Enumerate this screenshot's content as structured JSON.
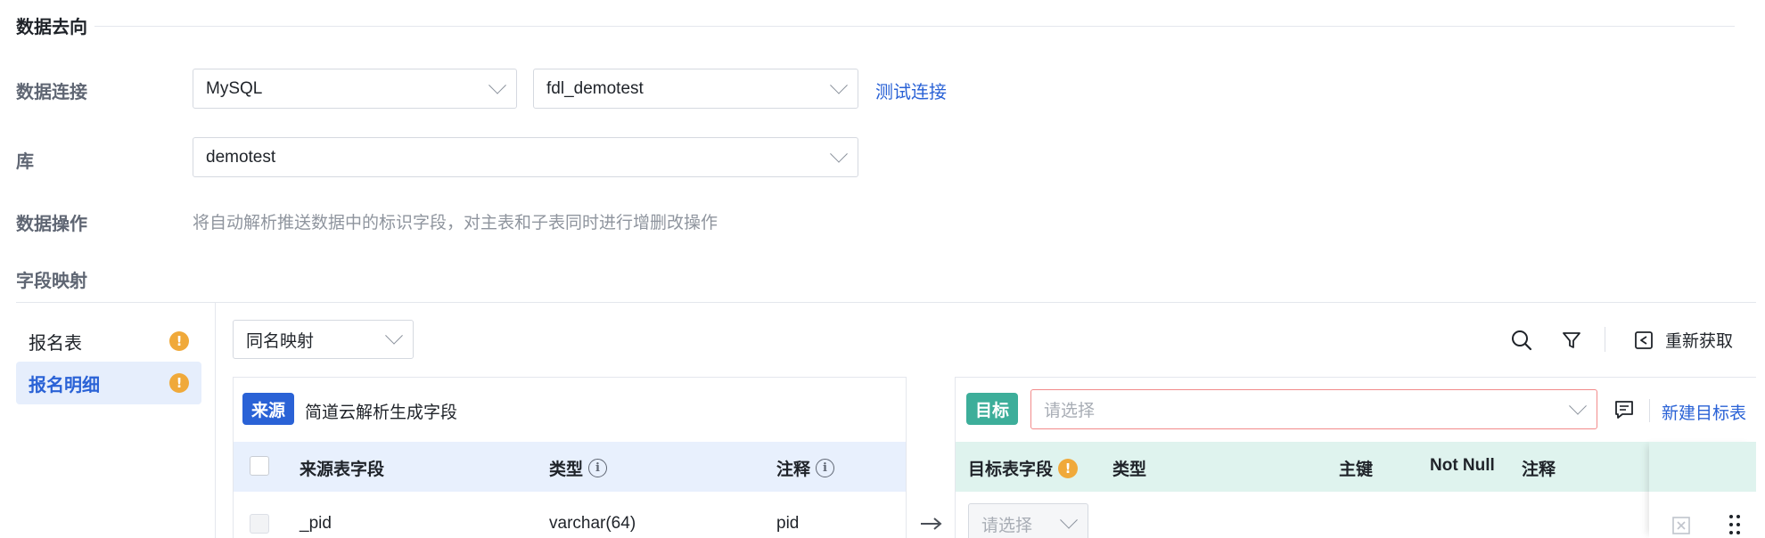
{
  "section": {
    "title": "数据去向"
  },
  "form": {
    "connection_label": "数据连接",
    "connection_type": "MySQL",
    "connection_name": "fdl_demotest",
    "test_connection": "测试连接",
    "db_label": "库",
    "db_value": "demotest",
    "operation_label": "数据操作",
    "operation_desc": "将自动解析推送数据中的标识字段，对主表和子表同时进行增删改操作",
    "mapping_label": "字段映射"
  },
  "sidebar": {
    "items": [
      {
        "label": "报名表",
        "active": false,
        "warning": true
      },
      {
        "label": "报名明细",
        "active": true,
        "warning": true
      }
    ]
  },
  "toolbar": {
    "mapping_mode": "同名映射",
    "refetch_label": "重新获取"
  },
  "source": {
    "tag": "来源",
    "title": "简道云解析生成字段",
    "columns": [
      "来源表字段",
      "类型",
      "注释"
    ],
    "rows": [
      {
        "field": "_pid",
        "type": "varchar(64)",
        "comment": "pid"
      }
    ]
  },
  "target": {
    "tag": "目标",
    "select_placeholder": "请选择",
    "new_table_label": "新建目标表",
    "columns": [
      "目标表字段",
      "类型",
      "主键",
      "Not Null",
      "注释"
    ],
    "row_select_placeholder": "请选择"
  },
  "colors": {
    "primary": "#2a62d6",
    "target_green": "#3dae9a",
    "warning": "#f0a93a",
    "error_border": "#f28b8b",
    "source_header_bg": "#e8f0fd",
    "target_header_bg": "#dff3ee"
  }
}
